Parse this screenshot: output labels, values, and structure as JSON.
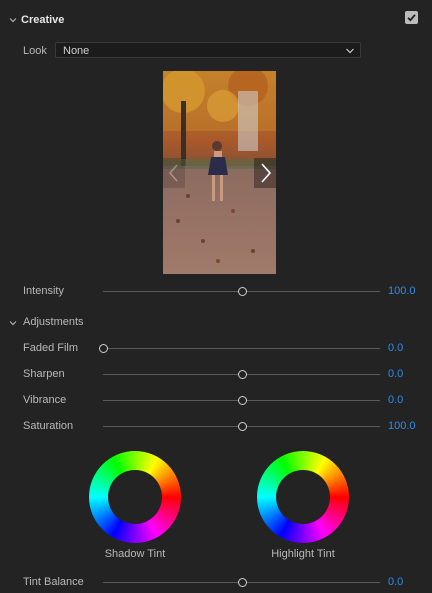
{
  "section": {
    "title": "Creative",
    "enabled": true
  },
  "look": {
    "label": "Look",
    "value": "None"
  },
  "preview": {
    "prev_icon": "chevron-left-icon",
    "next_icon": "chevron-right-icon"
  },
  "intensity": {
    "label": "Intensity",
    "value": "100.0",
    "fraction": 0.5
  },
  "adjustments": {
    "title": "Adjustments",
    "sliders": [
      {
        "label": "Faded Film",
        "value": "0.0",
        "fraction": 0.0
      },
      {
        "label": "Sharpen",
        "value": "0.0",
        "fraction": 0.5
      },
      {
        "label": "Vibrance",
        "value": "0.0",
        "fraction": 0.5
      },
      {
        "label": "Saturation",
        "value": "100.0",
        "fraction": 0.5
      }
    ]
  },
  "wheels": {
    "shadow_label": "Shadow Tint",
    "highlight_label": "Highlight Tint"
  },
  "tint_balance": {
    "label": "Tint Balance",
    "value": "0.0",
    "fraction": 0.5
  },
  "colors": {
    "accent": "#2d8ceb",
    "background": "#232323"
  }
}
